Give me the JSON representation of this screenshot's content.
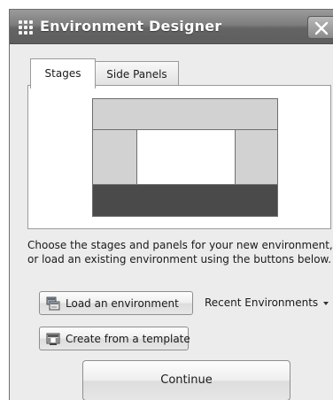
{
  "window": {
    "title": "Environment Designer"
  },
  "tabs": [
    {
      "label": "Stages",
      "selected": true
    },
    {
      "label": "Side Panels",
      "selected": false
    }
  ],
  "icons": {
    "app": "grid-icon",
    "close": "close-icon",
    "load": "load-environment-icon",
    "template": "template-icon",
    "recent_caret": "chevron-down-icon"
  },
  "preview_colors": {
    "panel": "#d2d2d2",
    "stage": "#ffffff",
    "bottom": "#4a4a4a"
  },
  "main": {
    "description": "Choose the stages and panels for your new environment, or load an existing environment using the buttons below."
  },
  "buttons": {
    "load": "Load an environment",
    "template": "Create from a template",
    "continue": "Continue"
  },
  "recent": {
    "label": "Recent Environments"
  }
}
